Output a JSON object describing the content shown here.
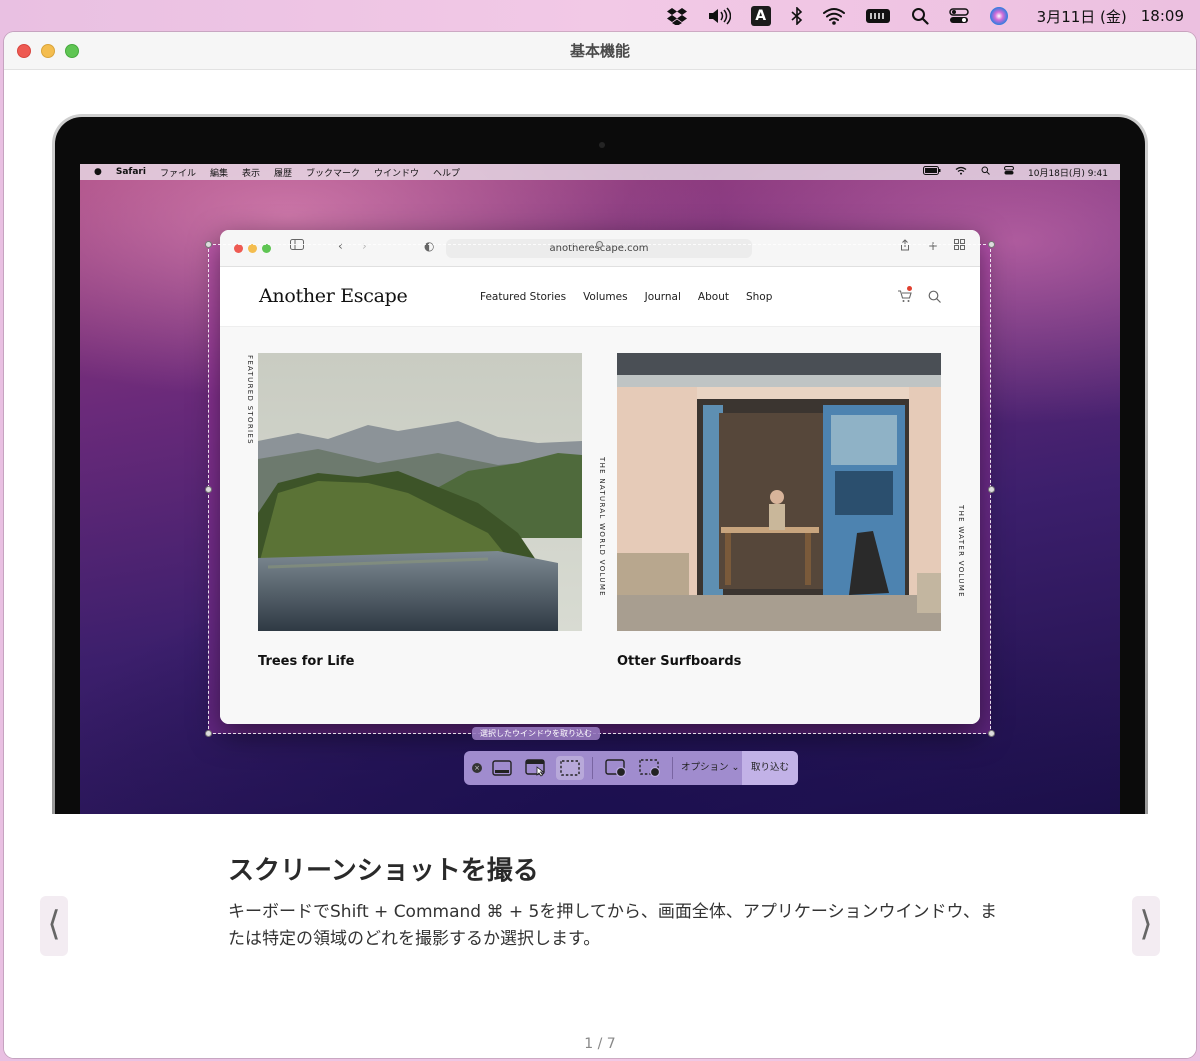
{
  "menubar": {
    "icons": [
      "dropbox-icon",
      "volume-icon",
      "input-source-icon",
      "bluetooth-icon",
      "wifi-icon",
      "keyboard-icon",
      "spotlight-icon",
      "control-center-icon",
      "siri-icon"
    ],
    "input_source": "A",
    "date": "3月11日 (金)",
    "time": "18:09"
  },
  "window": {
    "title": "基本機能"
  },
  "screen": {
    "menu": {
      "app": "Safari",
      "items": [
        "ファイル",
        "編集",
        "表示",
        "履歴",
        "ブックマーク",
        "ウインドウ",
        "ヘルプ"
      ],
      "datetime": "10月18日(月) 9:41"
    },
    "safari": {
      "url": "anotherescape.com",
      "site": {
        "logo": "Another Escape",
        "nav": [
          "Featured Stories",
          "Volumes",
          "Journal",
          "About",
          "Shop"
        ],
        "side_label": "FEATURED STORIES",
        "cards": [
          {
            "title": "Trees for Life",
            "label": "THE NATURAL WORLD VOLUME"
          },
          {
            "title": "Otter Surfboards",
            "label": "THE WATER VOLUME"
          }
        ]
      }
    },
    "capture": {
      "hint": "選択したウインドウを取り込む",
      "options_label": "オプション",
      "capture_label": "取り込む",
      "close_glyph": "×"
    }
  },
  "tour": {
    "heading": "スクリーンショットを撮る",
    "body": "キーボードでShift + Command ⌘ + 5を押してから、画面全体、アプリケーションウインドウ、または特定の領域のどれを撮影するか選択します。",
    "prev": "⟨",
    "next": "⟩",
    "pager": "1 / 7"
  }
}
